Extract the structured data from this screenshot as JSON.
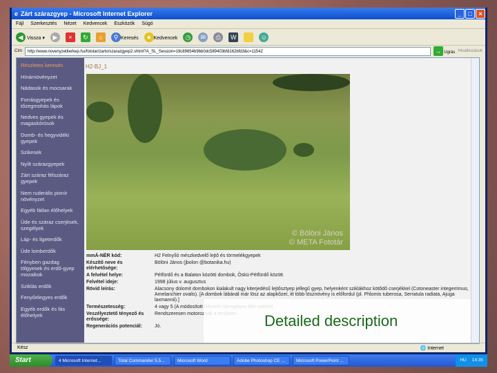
{
  "window": {
    "title": "Zárt szárazgyep - Microsoft Internet Explorer"
  },
  "menu": [
    "Fájl",
    "Szerkesztés",
    "Nézet",
    "Kedvencek",
    "Eszközök",
    "Súgó"
  ],
  "toolbar": {
    "back": "Vissza",
    "search": "Keresés",
    "favorites": "Kedvencek"
  },
  "address": {
    "label": "Cím",
    "url": "http://www.novenyzetiterkep.hu/fototar/zarto/szarazgyep2.shtml?A_SL_Session=19c89654b9bb0dc589403bfd162bfd3&c=11542",
    "go": "Ugrás",
    "links": "Hivatkozások"
  },
  "sidebar": [
    "Részletes keresés",
    "Hínárnövényzet",
    "Nádasok és mocsarak",
    "Forrásgyepek és tőzegmohás lápok",
    "Nedves gyepek és magaskórósok",
    "Domb- és hegyvidéki gyepek",
    "Szikesek",
    "Nyílt szárazgyepek",
    "Zárt száraz félszáraz gyepek",
    "Nem ruderális pionír növényzet",
    "Egyéb fátlan élőhelyek",
    "Üde és száraz cserjések, szegélyek",
    "Láp- és ligeterdők",
    "Üde lomberdők",
    "Fényben gazdag tölgyesek és erdő-gyep mozaikok",
    "Sziklás erdők",
    "Fenyőelegyes erdők",
    "Egyéb erdők és fás élőhelyek"
  ],
  "page": {
    "code": "H2-BJ_1",
    "credit1": "© Bölöni János",
    "credit2": "© META Fototár"
  },
  "info": [
    {
      "k": "mmÁ-NÉR kód:",
      "v": "H2 Felnyíló mészkedvelő lejtő és törmelékgyepek"
    },
    {
      "k": "Készítő neve és elérhetősége:",
      "v": "Bölöni János (jbolon @botanika.hu)"
    },
    {
      "k": "A felvétel helye:",
      "v": "Pétfürdő és a Balaton közötti dombok, Öskü-Pétfürdő között"
    },
    {
      "k": "Felvétel ideje:",
      "v": "1998 július v. augusztus"
    },
    {
      "k": "Rövid leírás:",
      "v": "Alacsony dolomit dombokon kialakult nagy kiterjedésű lejtősztyep jellegű gyep, helyenként sziklákhoz kötődő cserjékkel (Cotoneaster integerrimus, Amelanchier ovalis). [A dombok lábánál már lösz az alapkőzet, itt több lösznövény is előfordul (pl. Phlomis tuberosa, Serratula radiata, Ajuga laxmannii).]"
    },
    {
      "k": "Természetesség:",
      "v": "4 vagy 5 (A módosított Németh-Seregélyes féle szerint)"
    },
    {
      "k": "Veszélyeztető tényező és erőssége:",
      "v": "Rendszeresen motoroznak a területen."
    },
    {
      "k": "Regenerációs potenciál:",
      "v": "Jó."
    }
  ],
  "overlay": "Detailed description",
  "status": {
    "text": "Kész",
    "zone": "Internet"
  },
  "taskbar": {
    "start": "Start",
    "items": [
      "4 Microsoft Internet...",
      "Total Commander 5.5...",
      "Microsoft Word",
      "Adobe Photoshop CE ...",
      "Microsoft PowerPoint ..."
    ],
    "lang": "HU",
    "clock": "14:35"
  }
}
